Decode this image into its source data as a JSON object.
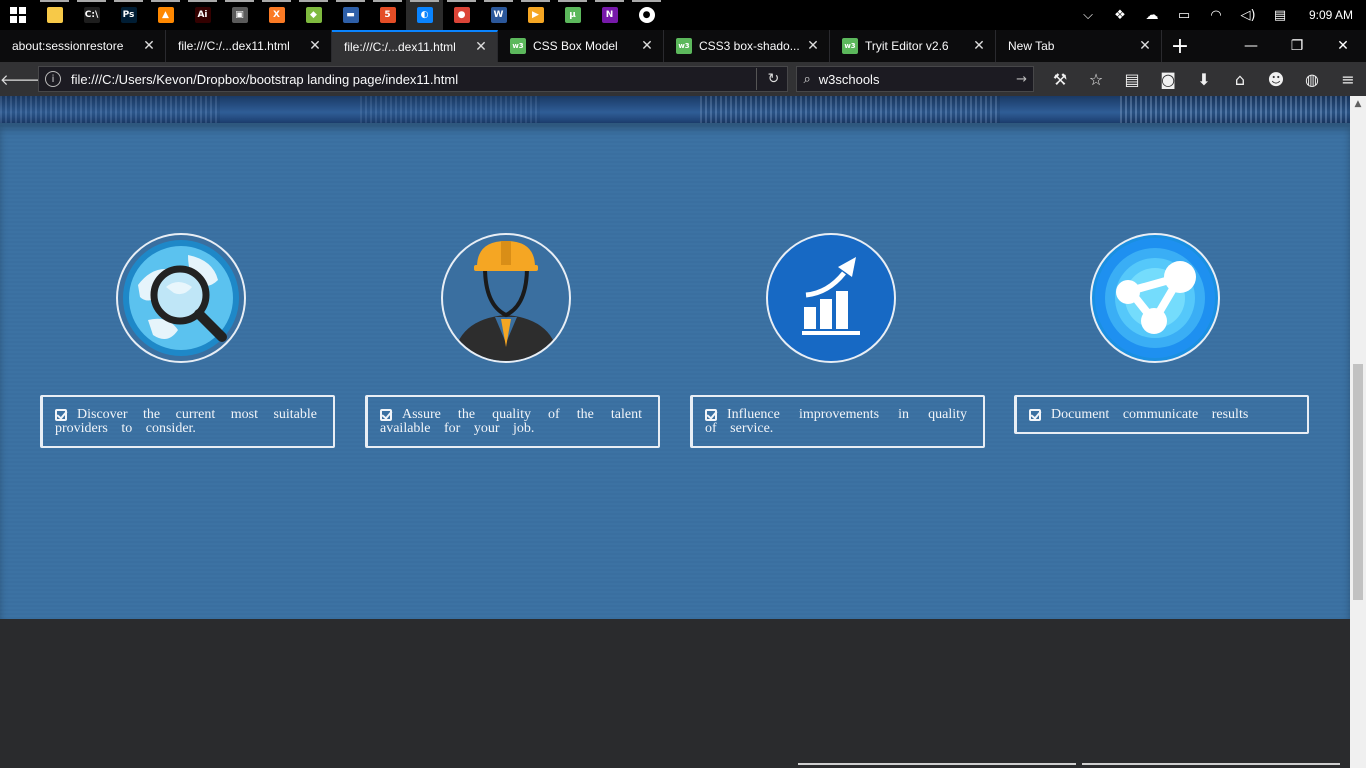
{
  "taskbar": {
    "clock": "9:09 AM",
    "apps": [
      {
        "icon": "file-explorer-icon",
        "color": "#f7c948",
        "glyph": ""
      },
      {
        "icon": "command-prompt-icon",
        "color": "#1e1e1e",
        "glyph": "C:\\"
      },
      {
        "icon": "photoshop-icon",
        "color": "#001d34",
        "glyph": "Ps"
      },
      {
        "icon": "vlc-icon",
        "color": "#ff8800",
        "glyph": "▲"
      },
      {
        "icon": "illustrator-icon",
        "color": "#330000",
        "glyph": "Ai"
      },
      {
        "icon": "media-app-icon",
        "color": "#5a5a5a",
        "glyph": "▣"
      },
      {
        "icon": "xampp-icon",
        "color": "#fb7a24",
        "glyph": "X"
      },
      {
        "icon": "network-app-icon",
        "color": "#7fba3f",
        "glyph": "◆"
      },
      {
        "icon": "virtualbox-icon",
        "color": "#2e5fa8",
        "glyph": "▬"
      },
      {
        "icon": "html-editor-icon",
        "color": "#e44d26",
        "glyph": "5"
      },
      {
        "icon": "firefox-icon",
        "color": "#0a84ff",
        "glyph": "◐"
      },
      {
        "icon": "chrome-icon",
        "color": "#db4437",
        "glyph": "●"
      },
      {
        "icon": "word-icon",
        "color": "#2b579a",
        "glyph": "W"
      },
      {
        "icon": "media-player-icon",
        "color": "#f5a623",
        "glyph": "▶"
      },
      {
        "icon": "utorrent-icon",
        "color": "#5cb85c",
        "glyph": "µ"
      },
      {
        "icon": "onenote-icon",
        "color": "#7719aa",
        "glyph": "N"
      },
      {
        "icon": "chat-app-icon",
        "color": "#ffffff",
        "glyph": "●"
      }
    ],
    "tray": [
      "chevron-up-icon",
      "dropbox-icon",
      "sync-icon",
      "battery-icon",
      "wifi-icon",
      "volume-icon",
      "notifications-icon"
    ]
  },
  "tabs": [
    {
      "title": "about:sessionrestore",
      "favicon": false,
      "selected": false
    },
    {
      "title": "file:///C:/...dex11.html",
      "favicon": false,
      "selected": false
    },
    {
      "title": "file:///C:/...dex11.html",
      "favicon": false,
      "selected": true
    },
    {
      "title": "CSS Box Model",
      "favicon": true,
      "selected": false
    },
    {
      "title": "CSS3 box-shado...",
      "favicon": true,
      "selected": false
    },
    {
      "title": "Tryit Editor v2.6",
      "favicon": true,
      "selected": false
    },
    {
      "title": "New Tab",
      "favicon": false,
      "selected": false
    }
  ],
  "favicon_label": "w3",
  "navbar": {
    "url": "file:///C:/Users/Kevon/Dropbox/bootstrap landing page/index11.html",
    "search_value": "w3schools"
  },
  "features": [
    {
      "icon": "globe-magnifier-icon",
      "text": "Discover the current most suitable providers to consider."
    },
    {
      "icon": "engineer-icon",
      "text": "Assure the quality of the talent available for your job."
    },
    {
      "icon": "growth-chart-icon",
      "text": "Influence improvements in quality of service."
    },
    {
      "icon": "share-icon",
      "text": "Document communicate results"
    }
  ],
  "colors": {
    "section_bg": "#3a6fa0",
    "footer_bg": "#2a2b2d",
    "tab_accent": "#0a84ff"
  }
}
